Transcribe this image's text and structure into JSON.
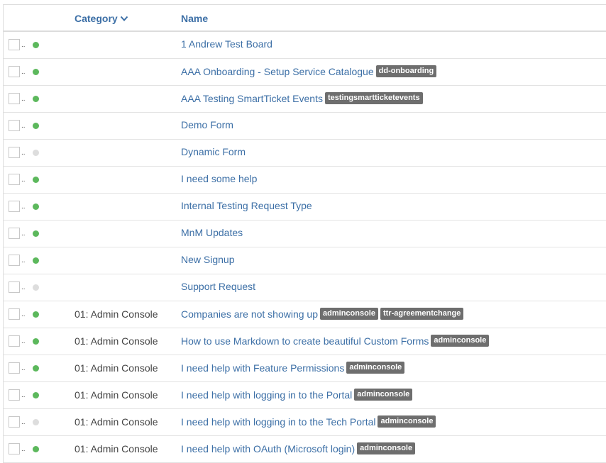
{
  "header": {
    "category_label": "Category",
    "name_label": "Name"
  },
  "colors": {
    "active": "#5cb85c",
    "inactive": "#dddddd",
    "link": "#3c6fa6",
    "tag": "#6e6e6e"
  },
  "rows": [
    {
      "status": "active",
      "category": "",
      "name": "1 Andrew Test Board",
      "tags": []
    },
    {
      "status": "active",
      "category": "",
      "name": "AAA Onboarding - Setup Service Catalogue",
      "tags": [
        "dd-onboarding"
      ]
    },
    {
      "status": "active",
      "category": "",
      "name": "AAA Testing SmartTicket Events",
      "tags": [
        "testingsmartticketevents"
      ]
    },
    {
      "status": "active",
      "category": "",
      "name": "Demo Form",
      "tags": []
    },
    {
      "status": "inactive",
      "category": "",
      "name": "Dynamic Form",
      "tags": []
    },
    {
      "status": "active",
      "category": "",
      "name": "I need some help",
      "tags": []
    },
    {
      "status": "active",
      "category": "",
      "name": "Internal Testing Request Type",
      "tags": []
    },
    {
      "status": "active",
      "category": "",
      "name": "MnM Updates",
      "tags": []
    },
    {
      "status": "active",
      "category": "",
      "name": "New Signup",
      "tags": []
    },
    {
      "status": "inactive",
      "category": "",
      "name": "Support Request",
      "tags": []
    },
    {
      "status": "active",
      "category": "01: Admin Console",
      "name": "Companies are not showing up",
      "tags": [
        "adminconsole",
        "ttr-agreementchange"
      ]
    },
    {
      "status": "active",
      "category": "01: Admin Console",
      "name": "How to use Markdown to create beautiful Custom Forms",
      "tags": [
        "adminconsole"
      ]
    },
    {
      "status": "active",
      "category": "01: Admin Console",
      "name": "I need help with Feature Permissions",
      "tags": [
        "adminconsole"
      ]
    },
    {
      "status": "active",
      "category": "01: Admin Console",
      "name": "I need help with logging in to the Portal",
      "tags": [
        "adminconsole"
      ]
    },
    {
      "status": "inactive",
      "category": "01: Admin Console",
      "name": "I need help with logging in to the Tech Portal",
      "tags": [
        "adminconsole"
      ]
    },
    {
      "status": "active",
      "category": "01: Admin Console",
      "name": "I need help with OAuth (Microsoft login)",
      "tags": [
        "adminconsole"
      ]
    }
  ]
}
